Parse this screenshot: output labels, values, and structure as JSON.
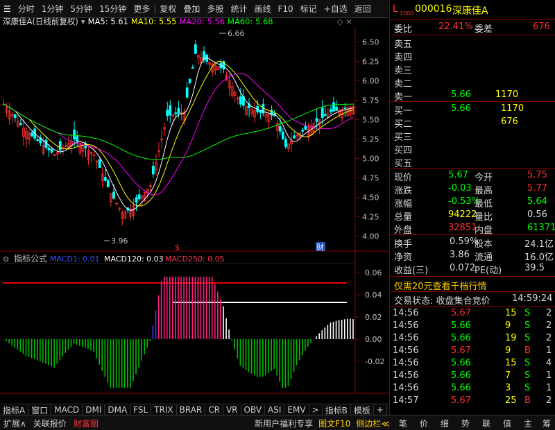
{
  "toolbar": {
    "items": [
      "分时",
      "1分钟",
      "5分钟",
      "15分钟",
      "更多",
      "复权",
      "叠加",
      "多股",
      "统计",
      "画线",
      "F10",
      "标记",
      "+自选",
      "返回"
    ]
  },
  "title": {
    "stock": "深康佳A",
    "mode": "(日线前复权)",
    "ma5": "MA5: 5.61",
    "ma10": "MA10: 5.55",
    "ma20": "MA20: 5.56",
    "ma60": "MA60: 5.68"
  },
  "colors": {
    "ma5": "#ffffff",
    "ma10": "#ffff00",
    "ma20": "#ff00ff",
    "ma60": "#00ff00",
    "up": "#ff3030",
    "down": "#00ffff"
  },
  "chart_data": {
    "type": "candlestick",
    "yticks": [
      "6.50",
      "6.25",
      "6.00",
      "5.75",
      "5.50",
      "5.25",
      "5.00",
      "4.75",
      "4.50",
      "4.25",
      "4.00"
    ],
    "high_label": "6.66",
    "low_label": "3.96",
    "x_labels": [
      "2022年",
      "4",
      "5",
      "6",
      "7",
      "8",
      "9"
    ],
    "markers": [
      "$",
      "财"
    ]
  },
  "indicator": {
    "name": "指标公式",
    "m1": "MACD1: 0.01",
    "m2": "MACD120: 0.03",
    "m3": "MACD250: 0.05",
    "yticks": [
      "0.06",
      "0.04",
      "0.02",
      "0.00",
      "-0.02"
    ]
  },
  "right": {
    "code": "000016",
    "name": "深康佳A",
    "l_label": "L",
    "l_sub": "1000",
    "weibi_label": "委比",
    "weibi": "22.41%",
    "weicha_label": "委差",
    "weicha": "676",
    "sells": [
      {
        "l": "卖五",
        "p": "",
        "v": ""
      },
      {
        "l": "卖四",
        "p": "",
        "v": ""
      },
      {
        "l": "卖三",
        "p": "",
        "v": ""
      },
      {
        "l": "卖二",
        "p": "",
        "v": ""
      },
      {
        "l": "卖一",
        "p": "5.66",
        "v": "1170"
      }
    ],
    "buys": [
      {
        "l": "买一",
        "p": "5.66",
        "v": "1170"
      },
      {
        "l": "买二",
        "p": "",
        "v": "676"
      },
      {
        "l": "买三",
        "p": "",
        "v": ""
      },
      {
        "l": "买四",
        "p": "",
        "v": ""
      },
      {
        "l": "买五",
        "p": "",
        "v": ""
      }
    ],
    "stats": [
      {
        "a": "现价",
        "av": "5.67",
        "b": "今开",
        "bv": "5.75"
      },
      {
        "a": "涨跌",
        "av": "-0.03",
        "b": "最高",
        "bv": "5.77"
      },
      {
        "a": "涨幅",
        "av": "-0.53%",
        "b": "最低",
        "bv": "5.64"
      },
      {
        "a": "总量",
        "av": "94222",
        "b": "量比",
        "bv": "0.56"
      },
      {
        "a": "外盘",
        "av": "32851",
        "b": "内盘",
        "bv": "61371"
      }
    ],
    "stats2": [
      {
        "a": "换手",
        "av": "0.59%",
        "b": "股本",
        "bv": "24.1亿"
      },
      {
        "a": "净资",
        "av": "3.86",
        "b": "流通",
        "bv": "16.0亿"
      },
      {
        "a": "收益(三)",
        "av": "0.072",
        "b": "PE(动)",
        "bv": "39.5"
      }
    ],
    "promo": "仅需20元查看千档行情",
    "status": "交易状态: 收盘集合竞价",
    "status_time": "14:59:24",
    "ticks": [
      {
        "t": "14:56",
        "p": "5.67",
        "v": "15",
        "s": "S",
        "n": "2"
      },
      {
        "t": "14:56",
        "p": "5.66",
        "v": "9",
        "s": "S",
        "n": "2"
      },
      {
        "t": "14:56",
        "p": "5.66",
        "v": "19",
        "s": "S",
        "n": "2"
      },
      {
        "t": "14:56",
        "p": "5.67",
        "v": "9",
        "s": "B",
        "n": "1"
      },
      {
        "t": "14:56",
        "p": "5.66",
        "v": "15",
        "s": "S",
        "n": "4"
      },
      {
        "t": "14:56",
        "p": "5.66",
        "v": "7",
        "s": "S",
        "n": "1"
      },
      {
        "t": "14:56",
        "p": "5.66",
        "v": "3",
        "s": "S",
        "n": "1"
      },
      {
        "t": "14:57",
        "p": "5.67",
        "v": "25",
        "s": "B",
        "n": "2"
      }
    ]
  },
  "tabs": [
    "指标A",
    "窗口",
    "MACD",
    "DMI",
    "DMA",
    "FSL",
    "TRIX",
    "BRAR",
    "CR",
    "VR",
    "OBV",
    "ASI",
    "EMV",
    ">",
    "指标B",
    "模板",
    "+",
    "-",
    "日线"
  ],
  "bottom": {
    "left": [
      "扩展∧",
      "关联报价",
      "财富圈"
    ],
    "mid": [
      "新用户福利专享",
      "图文F10",
      "侧边栏≪"
    ],
    "right": [
      "笔",
      "价",
      "细",
      "势",
      "联",
      "值",
      "主",
      "筹"
    ]
  }
}
